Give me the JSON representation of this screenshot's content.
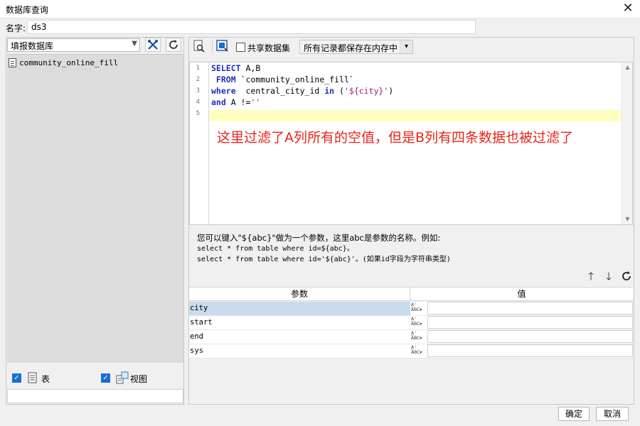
{
  "window": {
    "title": "数据库查询",
    "close_label": "✕"
  },
  "name_field": {
    "label": "名字:",
    "value": "ds3"
  },
  "left": {
    "db_select": "填报数据库",
    "tree": [
      {
        "label": "community_online_fill"
      }
    ],
    "table_toggle": {
      "label": "表",
      "checked": true
    },
    "view_toggle": {
      "label": "视图",
      "checked": true
    }
  },
  "toolbar": {
    "share_label": "共享数据集",
    "share_checked": false,
    "memory_option": "所有记录都保存在内存中"
  },
  "editor": {
    "lines": [
      {
        "num": "1",
        "segments": [
          {
            "text": "SELECT",
            "kind": "kw"
          },
          {
            "text": " A,B",
            "kind": "plain"
          }
        ]
      },
      {
        "num": "2",
        "segments": [
          {
            "text": " FROM",
            "kind": "kw"
          },
          {
            "text": " `community_online_fill`",
            "kind": "plain"
          }
        ]
      },
      {
        "num": "3",
        "segments": [
          {
            "text": "where",
            "kind": "kw"
          },
          {
            "text": "  central_city_id ",
            "kind": "plain"
          },
          {
            "text": "in",
            "kind": "kw"
          },
          {
            "text": " (",
            "kind": "plain"
          },
          {
            "text": "'${city}'",
            "kind": "str"
          },
          {
            "text": ")",
            "kind": "plain"
          }
        ]
      },
      {
        "num": "4",
        "segments": [
          {
            "text": "and",
            "kind": "kw"
          },
          {
            "text": " A !=",
            "kind": "plain"
          },
          {
            "text": "''",
            "kind": "str"
          }
        ]
      },
      {
        "num": "5",
        "segments": []
      }
    ],
    "annotation": "这里过滤了A列所有的空值，但是B列有四条数据也被过滤了"
  },
  "hint": {
    "line1": "您可以键入\"${abc}\"做为一个参数，这里abc是参数的名称。例如:",
    "line2": "select * from table where id=${abc}。",
    "line3": "select * from table where id='${abc}'。(如果id字段为字符串类型)"
  },
  "param_table": {
    "col_param": "参数",
    "col_value": "值",
    "rows": [
      {
        "name": "city",
        "value": ""
      },
      {
        "name": "start",
        "value": ""
      },
      {
        "name": "end",
        "value": ""
      },
      {
        "name": "sys",
        "value": ""
      }
    ]
  },
  "buttons": {
    "ok": "确定",
    "cancel": "取消"
  }
}
